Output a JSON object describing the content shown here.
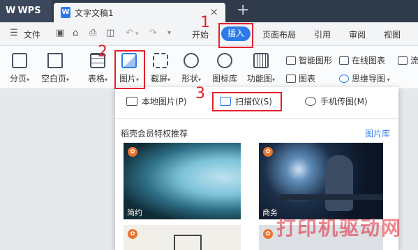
{
  "titlebar": {
    "app_name": "WPS",
    "doc_tab_title": "文字文稿1",
    "doc_icon_letter": "W",
    "close_glyph": "×",
    "new_tab_glyph": "+"
  },
  "menubar": {
    "file_label": "文件",
    "tabs": [
      "开始",
      "插入",
      "页面布局",
      "引用",
      "审阅",
      "视图"
    ],
    "active_tab": "插入"
  },
  "ribbon": {
    "buttons": [
      "分页",
      "空白页",
      "表格",
      "图片",
      "截屏",
      "形状",
      "图标库",
      "功能图"
    ],
    "right_items": [
      "智能图形",
      "在线图表",
      "图表",
      "思维导图",
      "流"
    ]
  },
  "dropdown": {
    "options": [
      "本地图片(P)",
      "扫描仪(S)",
      "手机传图(M)"
    ],
    "section_title": "稻壳会员特权推荐",
    "library_link": "图片库",
    "thumbnails": [
      "简约",
      "商务",
      "",
      ""
    ]
  },
  "annotations": {
    "step1": "1",
    "step2": "2",
    "step3": "3",
    "color": "#e2202d"
  },
  "watermark": "打印机驱动网",
  "colors": {
    "accent": "#2e7be8",
    "titlebar_bg": "#2f3a4a",
    "annotation_red": "#e2202d",
    "vip_badge": "#e8742e"
  }
}
